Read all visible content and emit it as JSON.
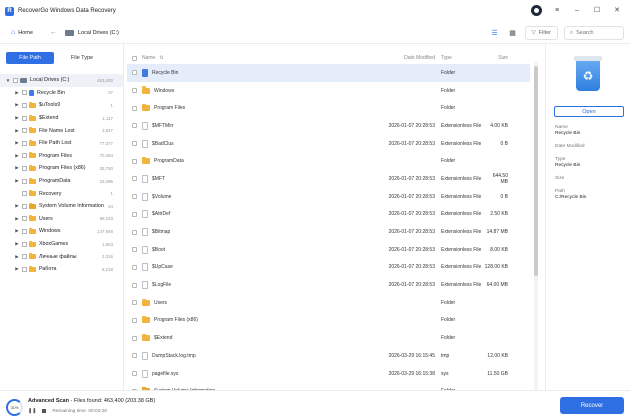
{
  "app": {
    "title": "RecoverGo Windows Data Recovery",
    "logo": "R"
  },
  "window_controls": {
    "minimize": "–",
    "maximize": "☐",
    "close": "✕"
  },
  "toolbar": {
    "home_label": "Home",
    "back_arrow": "←",
    "location": "Local Drives (C:)",
    "list_view": "☰",
    "grid_view": "▦",
    "filter_label": "Filter",
    "search_placeholder": "Search"
  },
  "sidebar": {
    "tabs": [
      {
        "label": "File Path"
      },
      {
        "label": "File Type"
      }
    ],
    "tree": [
      {
        "label": "Local Drives (C:)",
        "count": "463,400",
        "arrow": "▼",
        "icon": "drive"
      },
      {
        "label": "Recycle Bin",
        "count": "37",
        "arrow": "▶",
        "icon": "bin"
      },
      {
        "label": "$uTools9",
        "count": "1",
        "arrow": "▶",
        "icon": "folder"
      },
      {
        "label": "$Extend",
        "count": "1,117",
        "arrow": "▶",
        "icon": "folder"
      },
      {
        "label": "File Name Lost",
        "count": "3,847",
        "arrow": "▶",
        "icon": "folder"
      },
      {
        "label": "File Path Lost",
        "count": "77,377",
        "arrow": "▶",
        "icon": "folder"
      },
      {
        "label": "Program Files",
        "count": "70,484",
        "arrow": "▶",
        "icon": "folder"
      },
      {
        "label": "Program Files (x86)",
        "count": "28,750",
        "arrow": "▶",
        "icon": "folder"
      },
      {
        "label": "ProgramData",
        "count": "19,496",
        "arrow": "▶",
        "icon": "folder"
      },
      {
        "label": "Recovery",
        "count": "1",
        "arrow": "",
        "icon": "folder"
      },
      {
        "label": "System Volume Information",
        "count": "24",
        "arrow": "▶",
        "icon": "sys"
      },
      {
        "label": "Users",
        "count": "99,243",
        "arrow": "▶",
        "icon": "folder"
      },
      {
        "label": "Windows",
        "count": "147,948",
        "arrow": "▶",
        "icon": "folder"
      },
      {
        "label": "XboxGames",
        "count": "1,863",
        "arrow": "▶",
        "icon": "folder"
      },
      {
        "label": "Личные файлы",
        "count": "3,316",
        "arrow": "▶",
        "icon": "folder"
      },
      {
        "label": "Работа",
        "count": "8,218",
        "arrow": "▶",
        "icon": "folder"
      }
    ]
  },
  "list": {
    "headers": {
      "name": "Name",
      "sort": "⇅",
      "date": "Date Modified",
      "type": "Type",
      "size": "Size"
    },
    "rows": [
      {
        "name": "Recycle Bin",
        "date": "",
        "type": "Folder",
        "size": "",
        "icon": "bin"
      },
      {
        "name": "Windows",
        "date": "",
        "type": "Folder",
        "size": "",
        "icon": "folder"
      },
      {
        "name": "Program Files",
        "date": "",
        "type": "Folder",
        "size": "",
        "icon": "folder"
      },
      {
        "name": "$MFTMirr",
        "date": "2026-01-07 20:28:53",
        "type": "Extensionless File",
        "size": "4.00 KB",
        "icon": "file"
      },
      {
        "name": "$BadClus",
        "date": "2026-01-07 20:28:53",
        "type": "Extensionless File",
        "size": "0 B",
        "icon": "file"
      },
      {
        "name": "ProgramData",
        "date": "",
        "type": "Folder",
        "size": "",
        "icon": "folder"
      },
      {
        "name": "$MFT",
        "date": "2026-01-07 20:28:53",
        "type": "Extensionless File",
        "size": "644.50 MB",
        "icon": "file"
      },
      {
        "name": "$Volume",
        "date": "2026-01-07 20:28:53",
        "type": "Extensionless File",
        "size": "0 B",
        "icon": "file"
      },
      {
        "name": "$AttrDef",
        "date": "2026-01-07 20:28:53",
        "type": "Extensionless File",
        "size": "2.50 KB",
        "icon": "file"
      },
      {
        "name": "$Bitmap",
        "date": "2026-01-07 20:28:53",
        "type": "Extensionless File",
        "size": "14.87 MB",
        "icon": "file"
      },
      {
        "name": "$Boot",
        "date": "2026-01-07 20:28:53",
        "type": "Extensionless File",
        "size": "8.00 KB",
        "icon": "file"
      },
      {
        "name": "$UpCase",
        "date": "2026-01-07 20:28:53",
        "type": "Extensionless File",
        "size": "128.00 KB",
        "icon": "file"
      },
      {
        "name": "$LogFile",
        "date": "2026-01-07 20:28:53",
        "type": "Extensionless File",
        "size": "64.00 MB",
        "icon": "file"
      },
      {
        "name": "Users",
        "date": "",
        "type": "Folder",
        "size": "",
        "icon": "folder"
      },
      {
        "name": "Program Files (x86)",
        "date": "",
        "type": "Folder",
        "size": "",
        "icon": "folder"
      },
      {
        "name": "$Extend",
        "date": "",
        "type": "Folder",
        "size": "",
        "icon": "folder"
      },
      {
        "name": "DumpStack.log.tmp",
        "date": "2026-03-29 16:15:45",
        "type": "tmp",
        "size": "12.00 KB",
        "icon": "file"
      },
      {
        "name": "pagefile.sys",
        "date": "2026-03-29 16:15:38",
        "type": "sys",
        "size": "11.50 GB",
        "icon": "file"
      },
      {
        "name": "System Volume Information",
        "date": "",
        "type": "Folder",
        "size": "",
        "icon": "sys"
      }
    ]
  },
  "details": {
    "open_label": "Open",
    "bin_glyph": "♻",
    "fields": [
      {
        "label": "Name",
        "value": "Recycle Bin"
      },
      {
        "label": "Date Modified",
        "value": ""
      },
      {
        "label": "Type",
        "value": "Recycle Bin"
      },
      {
        "label": "Size",
        "value": ""
      },
      {
        "label": "Path",
        "value": "C:/Recycle Bin"
      }
    ]
  },
  "status": {
    "progress_label": "31%",
    "progress": 0.31,
    "scan_label": "Advanced Scan",
    "files_found": " - Files found: 463,400 (203.38 GB)",
    "remaining": "Remaining time: 00:03:20",
    "pause_glyph": "❚❚",
    "recover_label": "Recover"
  },
  "colors": {
    "accent": "#2f6fe4",
    "folder": "#f3b43f",
    "selected_row": "#e5edfa"
  }
}
